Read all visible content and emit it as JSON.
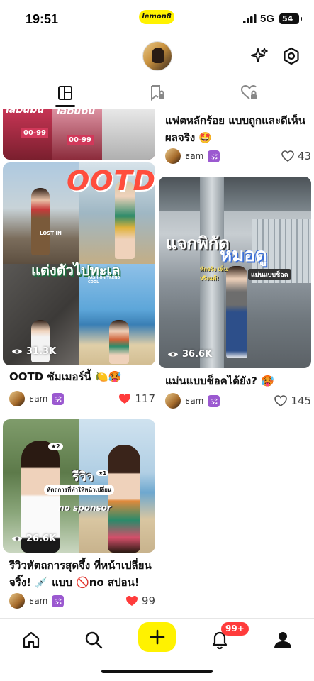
{
  "status": {
    "time": "19:51",
    "app_pill": "lemon8",
    "network": "5G",
    "battery": "54"
  },
  "colors": {
    "accent": "#fff200",
    "like_red": "#ff3b3b",
    "badge": "#ff3b3b"
  },
  "header": {
    "avatar": "profile-avatar",
    "icons": [
      "sparkle-icon",
      "settings-icon"
    ]
  },
  "tabs": [
    {
      "name": "posts",
      "icon": "grid-icon",
      "active": true
    },
    {
      "name": "saved",
      "icon": "bookmark-lock-icon",
      "active": false
    },
    {
      "name": "liked",
      "icon": "heart-lock-icon",
      "active": false
    }
  ],
  "posts": [
    {
      "id": "p1",
      "thumb_text": [
        "labubu",
        "labubu",
        "00-99",
        "00-99"
      ],
      "title_line1": "",
      "title_line2": "",
      "author": "",
      "likes": ""
    },
    {
      "id": "p2",
      "thumb_text": [],
      "title_line1": "แฟตหลักร้อย แบบถูกและดีเห็น",
      "title_line2": "ผลจริง 🤩",
      "author": "ธam",
      "author_badge": "🕉",
      "likes": "43",
      "liked": false
    },
    {
      "id": "p3",
      "thumb_text": [
        "OOTD",
        "แต่งตัวไปทะเล",
        "LOST IN",
        "FASHION TREND COOL"
      ],
      "views": "31.3K",
      "title_line1": "OOTD ซัมเมอร์นี้ 🍋🥵",
      "author": "ธam",
      "author_badge": "🕉",
      "likes": "117",
      "liked": true
    },
    {
      "id": "p4",
      "thumb_text": [
        "แจกพิกัด",
        "หมอดู",
        "ทักจริง เห็นจริงแท้!",
        "แม่นแบบช็อค"
      ],
      "views": "36.6K",
      "title_line1": "แม่นแบบช็อคได้ยัง? 🥵",
      "author": "ธam",
      "author_badge": "🕉",
      "likes": "145",
      "liked": false
    },
    {
      "id": "p5",
      "thumb_text": [
        "รีวิว",
        "หัตถการที่ทำให้หน้าเปลี่ยน",
        "no sponsor",
        "★2",
        "★1"
      ],
      "views": "26.6K",
      "title_line1": "รีวิวหัตถการสุดจึ้ง ที่หน้าเปลี่ยน",
      "title_line2": "จริ๊ง! 💉 แบบ 🚫no สปอน!",
      "author": "ธam",
      "author_badge": "🕉",
      "likes": "99",
      "liked": true
    }
  ],
  "bottom_nav": {
    "items": [
      "home-icon",
      "search-icon",
      "plus-icon",
      "bell-icon",
      "profile-icon"
    ],
    "notification_badge": "99+"
  }
}
